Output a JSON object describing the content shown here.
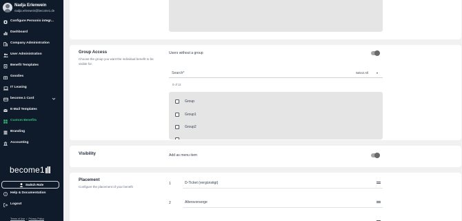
{
  "user": {
    "name": "Nadja Erlenwein",
    "email": "nadja.erlenwein@become1.de"
  },
  "sidebar": {
    "items": [
      {
        "label": "Configure Personio integr...",
        "icon": "plug-icon",
        "active": false
      },
      {
        "label": "Dashboard",
        "icon": "bar-chart-icon",
        "active": false
      },
      {
        "label": "Company Administration",
        "icon": "building-icon",
        "active": false
      },
      {
        "label": "User Administration",
        "icon": "users-icon",
        "active": false
      },
      {
        "label": "Benefit Templates",
        "icon": "file-icon",
        "active": false
      },
      {
        "label": "Goodies",
        "icon": "gift-icon",
        "active": false
      },
      {
        "label": "IT Leasing",
        "icon": "laptop-icon",
        "active": false
      },
      {
        "label": "become.1 Card",
        "icon": "credit-card-icon",
        "active": false,
        "expandable": true
      },
      {
        "label": "E-Mail Templates",
        "icon": "mail-icon",
        "active": false
      },
      {
        "label": "Custom Benefits",
        "icon": "grid-icon",
        "active": true
      },
      {
        "label": "Branding",
        "icon": "stack-icon",
        "active": false
      },
      {
        "label": "Accounting",
        "icon": "bank-icon",
        "active": false
      }
    ],
    "brand": "become1",
    "switch_role": "Switch Role",
    "help": "Help & Documentation",
    "logout": "Logout",
    "terms": "Terms of Use",
    "privacy": "Privacy Policy"
  },
  "group_access": {
    "title": "Group Access",
    "description": "Choose the group you want the individual benefit to be visible for.",
    "users_without_group": "Users without a group",
    "toggle_on": false,
    "search_placeholder": "Search*",
    "select_all": "Select All",
    "count": "0 of 12",
    "groups": [
      "Group",
      "Group1",
      "Group2"
    ]
  },
  "visibility": {
    "title": "Visibility",
    "add_menu_item": "Add as menu item",
    "toggle_on": false
  },
  "placement": {
    "title": "Placement",
    "description": "Configure the placement of your benefit",
    "items": [
      {
        "num": "1",
        "label": "D-Ticket (vergünstigt)"
      },
      {
        "num": "2",
        "label": "Altersvorsorge"
      }
    ]
  },
  "colors": {
    "sidebar_bg": "#0f1a2a",
    "accent": "#35c07a",
    "page_bg": "#f1f1f1"
  }
}
